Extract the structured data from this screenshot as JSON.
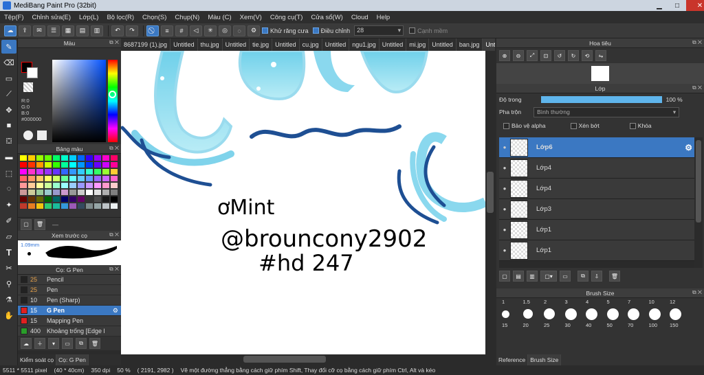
{
  "window": {
    "title": "MediBang Paint Pro (32bit)"
  },
  "menu": [
    "Tệp(F)",
    "Chỉnh sửa(E)",
    "Lớp(L)",
    "Bộ lọc(R)",
    "Chọn(S)",
    "Chụp(N)",
    "Màu (C)",
    "Xem(V)",
    "Công cụ(T)",
    "Cửa sổ(W)",
    "Cloud",
    "Help"
  ],
  "toolbar": {
    "antialias_label": "Khử răng cưa",
    "adjust_label": "Điều chỉnh",
    "adjust_value": "28",
    "smooth_label": "Cạnh mềm"
  },
  "color_panel": {
    "title": "Màu",
    "r": "R:0",
    "g": "G:0",
    "b": "B:0",
    "hex": "#000000"
  },
  "palette": {
    "title": "Bảng màu",
    "colors": [
      "#ffff00",
      "#ffcc00",
      "#99ff00",
      "#66ff00",
      "#00ff66",
      "#00ffcc",
      "#00ccff",
      "#0066ff",
      "#3300ff",
      "#9900ff",
      "#ff00cc",
      "#ff0066",
      "#ff0000",
      "#ff3300",
      "#ff9900",
      "#ccff00",
      "#33ff00",
      "#00ff99",
      "#00ffff",
      "#0099ff",
      "#0033ff",
      "#6600ff",
      "#cc00ff",
      "#ff0099",
      "#ff00ff",
      "#ff33cc",
      "#cc33ff",
      "#9933ff",
      "#6633ff",
      "#3366ff",
      "#3399ff",
      "#33ccff",
      "#33ffcc",
      "#33ff66",
      "#99ff33",
      "#ffcc33",
      "#ff6666",
      "#ff9966",
      "#ffcc66",
      "#ffff66",
      "#ccff66",
      "#66ff99",
      "#66ffff",
      "#66ccff",
      "#6699ff",
      "#9966ff",
      "#cc66ff",
      "#ff66cc",
      "#ff9999",
      "#ffcc99",
      "#ffff99",
      "#ccff99",
      "#99ffcc",
      "#99ffff",
      "#99ccff",
      "#9999ff",
      "#cc99ff",
      "#ff99ff",
      "#ff99cc",
      "#ffcccc",
      "#cc9999",
      "#cccc99",
      "#99cc99",
      "#99cccc",
      "#9999cc",
      "#cc99cc",
      "#999999",
      "#cccccc",
      "#ffffff",
      "#e0e0e0",
      "#b0b0b0",
      "#808080",
      "#660000",
      "#663300",
      "#666600",
      "#006600",
      "#006666",
      "#000066",
      "#330066",
      "#660066",
      "#333333",
      "#4d4d4d",
      "#1a1a1a",
      "#000000",
      "#c0392b",
      "#e67e22",
      "#f1c40f",
      "#2ecc71",
      "#1abc9c",
      "#3498db",
      "#9b59b6",
      "#34495e",
      "#7f8c8d",
      "#95a5a6",
      "#bdc3c7",
      "#ecf0f1"
    ]
  },
  "brush_preview": {
    "title": "Xem trước cọ",
    "size": "1.09mm"
  },
  "brush_panel": {
    "title": "Cọ: G Pen",
    "items": [
      {
        "size": "25",
        "name": "Pencil",
        "color": "#222222"
      },
      {
        "size": "25",
        "name": "Pen",
        "color": "#222222"
      },
      {
        "size": "10",
        "name": "Pen (Sharp)",
        "color": "#222222"
      },
      {
        "size": "15",
        "name": "G Pen",
        "color": "#e02020"
      },
      {
        "size": "15",
        "name": "Mapping Pen",
        "color": "#e02020"
      },
      {
        "size": "400",
        "name": "Khoảng trống [Edge l",
        "color": "#2a9d2a"
      }
    ]
  },
  "bottom_tabs": [
    "Kiểm soát cọ",
    "Cọ: G Pen"
  ],
  "doc_tabs": [
    "8687199 (1).jpg",
    "Untitled",
    "thu.jpg",
    "Untitled",
    "tie.jpg",
    "Untitled",
    "cu.jpg",
    "Untitled",
    "ngu1.jpg",
    "Untitled",
    "mi.jpg",
    "Untitled",
    "ban.jpg",
    "Untitled"
  ],
  "navigator": {
    "title": "Hoa tiêu"
  },
  "layer_panel": {
    "title": "Lớp",
    "opacity_label": "Độ trong",
    "opacity_value": "100 %",
    "blend_label": "Pha trộn",
    "blend_value": "Bình thường",
    "protect_alpha": "Bảo vệ alpha",
    "clipping": "Xén bớt",
    "lock": "Khóa",
    "layers": [
      "Lớp6",
      "Lớp4",
      "Lớp4",
      "Lớp3",
      "Lớp1",
      "Lớp1"
    ]
  },
  "brush_size": {
    "title": "Brush Size",
    "row1": [
      "1",
      "1.5",
      "2",
      "3",
      "4",
      "5",
      "7",
      "10",
      "12"
    ],
    "row2": [
      "15",
      "20",
      "25",
      "30",
      "40",
      "50",
      "70",
      "100",
      "150"
    ]
  },
  "right_tabs": [
    "Reference",
    "Brush Size"
  ],
  "status": {
    "size": "5511 * 5511 pixel",
    "cm": "(40 * 40cm)",
    "dpi": "350 dpi",
    "zoom": "50 %",
    "coords": "( 2191, 2982 )",
    "hint": "Vẽ một đường thẳng bằng cách giữ phím Shift, Thay đổi cỡ cọ bằng cách giữ phím Ctrl, Alt và kéo"
  },
  "artwork": {
    "line1": "ơMint",
    "line2": "@brouncony2902",
    "line3": "#hd 247"
  }
}
